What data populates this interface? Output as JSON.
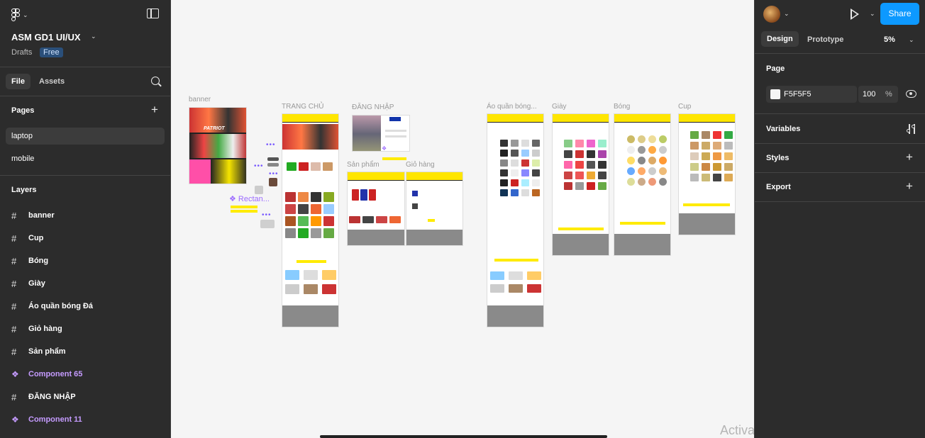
{
  "file": {
    "name": "ASM GD1 UI/UX",
    "location": "Drafts",
    "plan_badge": "Free"
  },
  "left_tabs": {
    "file": "File",
    "assets": "Assets"
  },
  "pages": {
    "title": "Pages",
    "items": [
      "laptop",
      "mobile"
    ],
    "active": "laptop"
  },
  "layers": {
    "title": "Layers",
    "items": [
      {
        "label": "banner",
        "kind": "frame"
      },
      {
        "label": "Cup",
        "kind": "frame"
      },
      {
        "label": "Bóng",
        "kind": "frame"
      },
      {
        "label": "Giày",
        "kind": "frame"
      },
      {
        "label": "Áo quần bóng Đá",
        "kind": "frame"
      },
      {
        "label": "Giỏ hàng",
        "kind": "frame"
      },
      {
        "label": "Sản phẩm",
        "kind": "frame"
      },
      {
        "label": "Component 65",
        "kind": "component"
      },
      {
        "label": "ĐĂNG NHẬP",
        "kind": "frame"
      },
      {
        "label": "Component 11",
        "kind": "component"
      }
    ]
  },
  "right": {
    "share": "Share",
    "tabs": {
      "design": "Design",
      "prototype": "Prototype"
    },
    "zoom": "5%",
    "page_section": "Page",
    "fill_hex": "F5F5F5",
    "opacity": "100",
    "opacity_unit": "%",
    "sections": [
      "Variables",
      "Styles",
      "Export"
    ]
  },
  "canvas": {
    "frames": {
      "banner": "banner",
      "trang_chu": "TRANG CHỦ",
      "dang_nhap": "ĐĂNG NHẬP",
      "san_pham": "Sản phẩm",
      "gio_hang": "Giỏ hàng",
      "ao_quan": "Áo quần bóng...",
      "giay": "Giày",
      "bong": "Bóng",
      "cup": "Cup"
    },
    "component_label": "Rectan...",
    "banner_text": "PATRIOT"
  },
  "watermark": "Activate Windows",
  "colors": {
    "accent": "#0d99ff",
    "component": "#9c6bff",
    "frame_header": "#ffe600",
    "canvas": "#f5f5f5"
  }
}
